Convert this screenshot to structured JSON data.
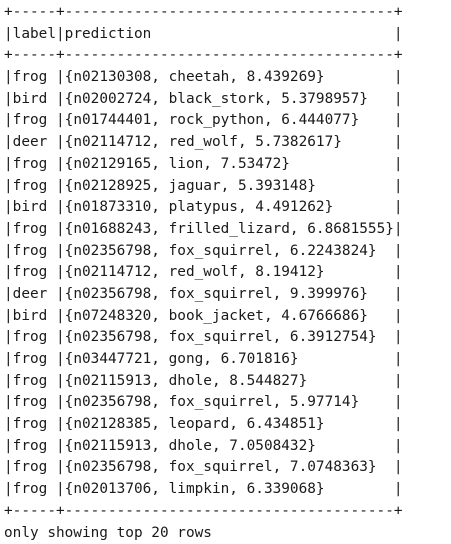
{
  "table": {
    "border_top": "+-----+--------------------------------------+",
    "header_label": "label",
    "header_prediction": "prediction",
    "border_mid": "+-----+--------------------------------------+",
    "rows": [
      {
        "label": "frog",
        "prediction": "{n02130308, cheetah, 8.439269}"
      },
      {
        "label": "bird",
        "prediction": "{n02002724, black_stork, 5.3798957}"
      },
      {
        "label": "frog",
        "prediction": "{n01744401, rock_python, 6.444077}"
      },
      {
        "label": "deer",
        "prediction": "{n02114712, red_wolf, 5.7382617}"
      },
      {
        "label": "frog",
        "prediction": "{n02129165, lion, 7.53472}"
      },
      {
        "label": "frog",
        "prediction": "{n02128925, jaguar, 5.393148}"
      },
      {
        "label": "bird",
        "prediction": "{n01873310, platypus, 4.491262}"
      },
      {
        "label": "frog",
        "prediction": "{n01688243, frilled_lizard, 6.8681555}"
      },
      {
        "label": "frog",
        "prediction": "{n02356798, fox_squirrel, 6.2243824}"
      },
      {
        "label": "frog",
        "prediction": "{n02114712, red_wolf, 8.19412}"
      },
      {
        "label": "deer",
        "prediction": "{n02356798, fox_squirrel, 9.399976}"
      },
      {
        "label": "bird",
        "prediction": "{n07248320, book_jacket, 4.6766686}"
      },
      {
        "label": "frog",
        "prediction": "{n02356798, fox_squirrel, 6.3912754}"
      },
      {
        "label": "frog",
        "prediction": "{n03447721, gong, 6.701816}"
      },
      {
        "label": "frog",
        "prediction": "{n02115913, dhole, 8.544827}"
      },
      {
        "label": "frog",
        "prediction": "{n02356798, fox_squirrel, 5.97714}"
      },
      {
        "label": "frog",
        "prediction": "{n02128385, leopard, 6.434851}"
      },
      {
        "label": "frog",
        "prediction": "{n02115913, dhole, 7.0508432}"
      },
      {
        "label": "frog",
        "prediction": "{n02356798, fox_squirrel, 7.0748363}"
      },
      {
        "label": "frog",
        "prediction": "{n02013706, limpkin, 6.339068}"
      }
    ],
    "border_bottom": "+-----+--------------------------------------+"
  },
  "footer": "only showing top 20 rows"
}
